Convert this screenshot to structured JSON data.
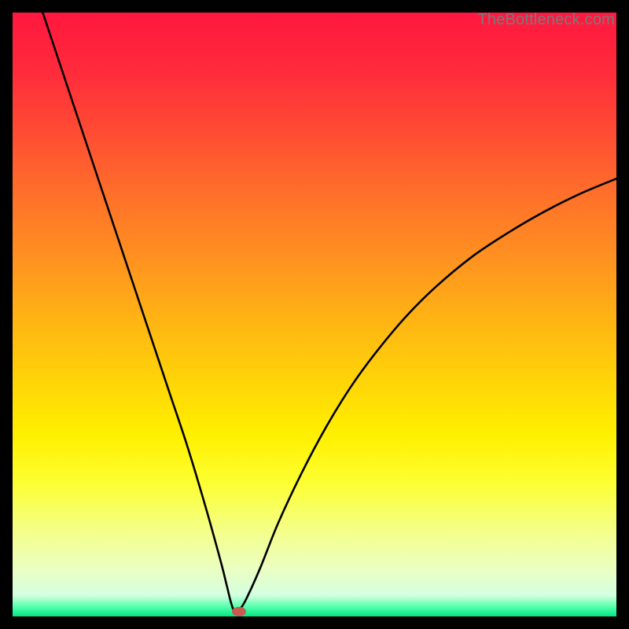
{
  "watermark": "TheBottleneck.com",
  "chart_data": {
    "type": "line",
    "title": "",
    "xlabel": "",
    "ylabel": "",
    "xlim": [
      0,
      100
    ],
    "ylim": [
      0,
      100
    ],
    "grid": false,
    "legend": false,
    "background_gradient": {
      "stops": [
        {
          "pos": 0.0,
          "color": "#ff173f"
        },
        {
          "pos": 0.1,
          "color": "#ff2c3b"
        },
        {
          "pos": 0.2,
          "color": "#ff4d33"
        },
        {
          "pos": 0.3,
          "color": "#ff6f2a"
        },
        {
          "pos": 0.4,
          "color": "#ff8f21"
        },
        {
          "pos": 0.5,
          "color": "#ffb115"
        },
        {
          "pos": 0.6,
          "color": "#ffd109"
        },
        {
          "pos": 0.7,
          "color": "#fff000"
        },
        {
          "pos": 0.78,
          "color": "#fdff33"
        },
        {
          "pos": 0.86,
          "color": "#f4ff8a"
        },
        {
          "pos": 0.92,
          "color": "#ebffc1"
        },
        {
          "pos": 0.965,
          "color": "#d4ffe0"
        },
        {
          "pos": 0.985,
          "color": "#4fffaa"
        },
        {
          "pos": 1.0,
          "color": "#00e884"
        }
      ]
    },
    "series": [
      {
        "name": "bottleneck-curve",
        "color": "#000000",
        "x": [
          5,
          8,
          11,
          14,
          17,
          20,
          23,
          26,
          29,
          32,
          34.5,
          35.5,
          36.2,
          36.8,
          38,
          37.2,
          38.5,
          41,
          44,
          48,
          52,
          56,
          60,
          65,
          70,
          76,
          82,
          88,
          94,
          100
        ],
        "y": [
          100,
          91,
          82,
          73,
          64,
          55,
          46,
          37,
          28,
          18,
          9,
          5,
          2.2,
          0.8,
          0.5,
          0.5,
          2.5,
          8,
          15.5,
          24,
          31.5,
          38,
          43.5,
          49.5,
          54.5,
          59.5,
          63.5,
          67,
          70,
          72.5
        ]
      }
    ],
    "marker": {
      "name": "optimum-marker",
      "x": 37.5,
      "y": 0.8,
      "color": "#c85a4f",
      "rx": 9,
      "ry": 6
    }
  }
}
